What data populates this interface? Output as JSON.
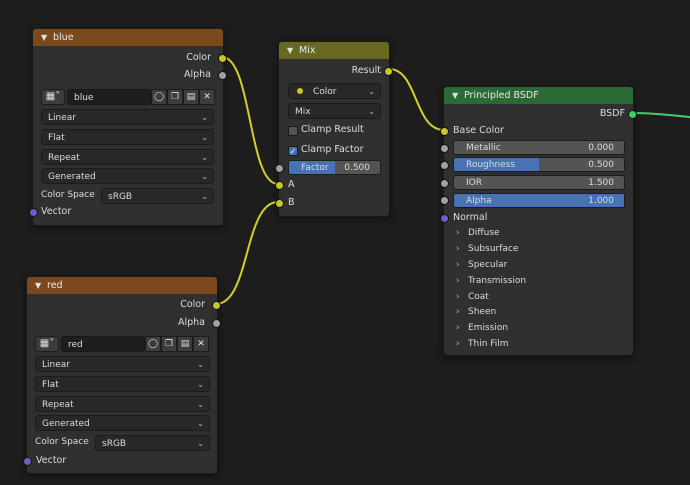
{
  "blue_node": {
    "title": "blue",
    "outputs": {
      "color": "Color",
      "alpha": "Alpha"
    },
    "image_name": "blue",
    "interpolation": "Linear",
    "projection": "Flat",
    "extension": "Repeat",
    "source": "Generated",
    "color_space_label": "Color Space",
    "color_space": "sRGB",
    "input_vector": "Vector"
  },
  "red_node": {
    "title": "red",
    "outputs": {
      "color": "Color",
      "alpha": "Alpha"
    },
    "image_name": "red",
    "interpolation": "Linear",
    "projection": "Flat",
    "extension": "Repeat",
    "source": "Generated",
    "color_space_label": "Color Space",
    "color_space": "sRGB",
    "input_vector": "Vector"
  },
  "mix_node": {
    "title": "Mix",
    "output": "Result",
    "data_type": "Color",
    "blend_mode": "Mix",
    "clamp_result": {
      "label": "Clamp Result",
      "checked": false
    },
    "clamp_factor": {
      "label": "Clamp Factor",
      "checked": true
    },
    "factor": {
      "label": "Factor",
      "value": "0.500",
      "fraction": 0.5
    },
    "input_a": "A",
    "input_b": "B"
  },
  "bsdf_node": {
    "title": "Principled BSDF",
    "output": "BSDF",
    "base_color": "Base Color",
    "metallic": {
      "label": "Metallic",
      "value": "0.000",
      "fraction": 0.0
    },
    "roughness": {
      "label": "Roughness",
      "value": "0.500",
      "fraction": 0.5
    },
    "ior": {
      "label": "IOR",
      "value": "1.500",
      "fraction": 0.0
    },
    "alpha": {
      "label": "Alpha",
      "value": "1.000",
      "fraction": 1.0
    },
    "normal": "Normal",
    "panels": [
      "Diffuse",
      "Subsurface",
      "Specular",
      "Transmission",
      "Coat",
      "Sheen",
      "Emission",
      "Thin Film"
    ]
  },
  "colors": {
    "background": "#1d1d1d",
    "node_body": "#303030",
    "texture_header": "#7a4a1e",
    "mix_header": "#68691f",
    "bsdf_header": "#2a6b35",
    "color_socket": "#c7c729",
    "float_socket": "#a1a1a1",
    "vector_socket": "#6363c7",
    "slider_fill": "#4772b3",
    "link_color": "#d4cf2a",
    "link_shader": "#3fcf6a"
  }
}
